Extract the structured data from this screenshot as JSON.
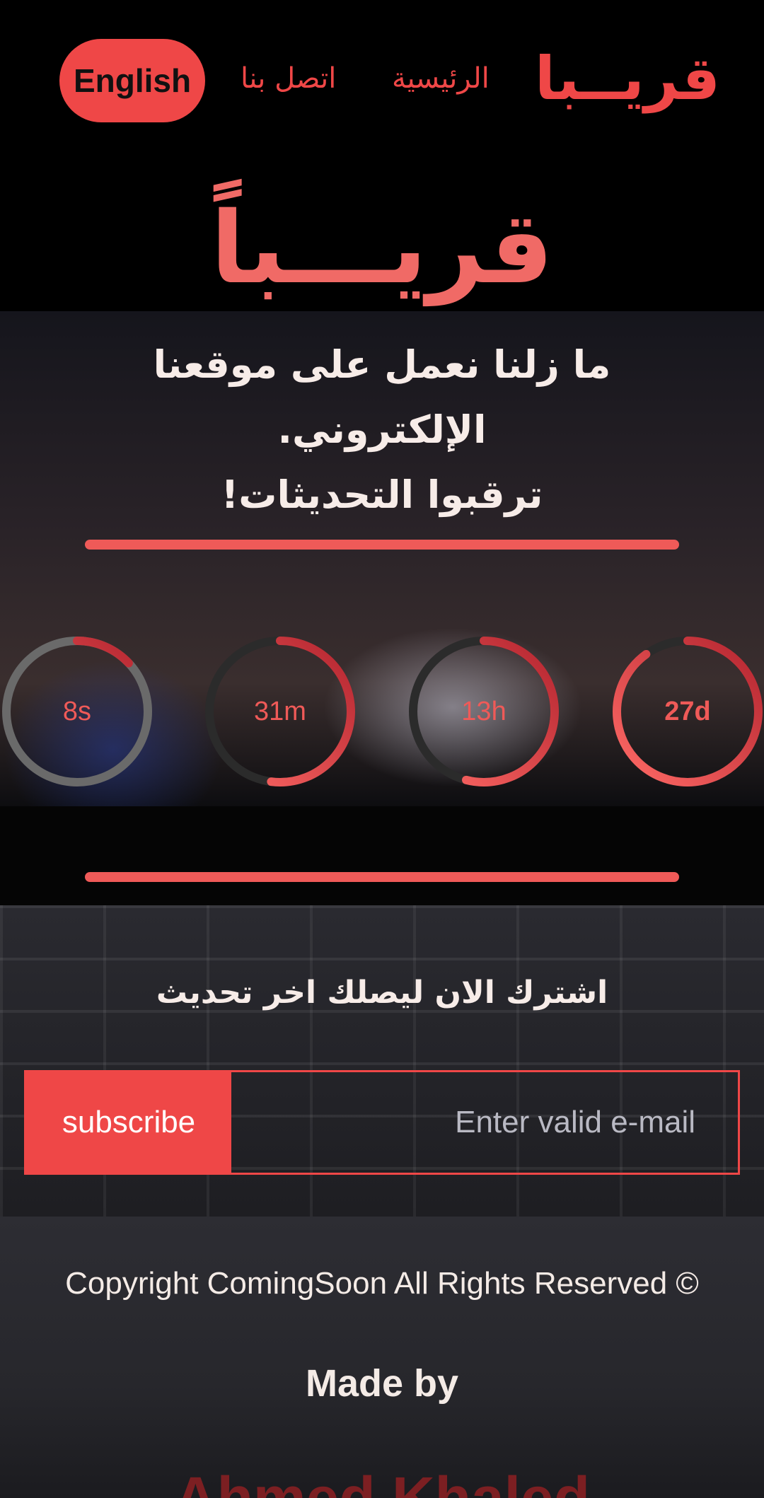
{
  "nav": {
    "language_button": "English",
    "links": {
      "contact": "اتصل بنا",
      "home": "الرئيسية"
    },
    "logo": "قريــبا"
  },
  "hero": {
    "title": "قريـــباً",
    "subtitle_line1": "ما زلنا نعمل على موقعنا الإلكتروني.",
    "subtitle_line2": "ترقبوا التحديثات!"
  },
  "countdown": [
    {
      "label": "27d",
      "progress": 0.9
    },
    {
      "label": "13h",
      "progress": 0.54
    },
    {
      "label": "31m",
      "progress": 0.52
    },
    {
      "label": "8s",
      "progress": 0.13
    }
  ],
  "subscribe": {
    "prompt": "اشترك الان ليصلك اخر تحديث",
    "button": "subscribe",
    "email_placeholder": "Enter valid e-mail",
    "email_value": ""
  },
  "footer": {
    "copyright": "Copyright ComingSoon All Rights Reserved ©",
    "made_by": "Made by",
    "author": "Ahmed Khaled"
  },
  "colors": {
    "accent": "#ef4747",
    "ring_track": "#2b2b2b",
    "ring_progress_start": "#ff6a66",
    "ring_progress_end": "#b3242f"
  }
}
